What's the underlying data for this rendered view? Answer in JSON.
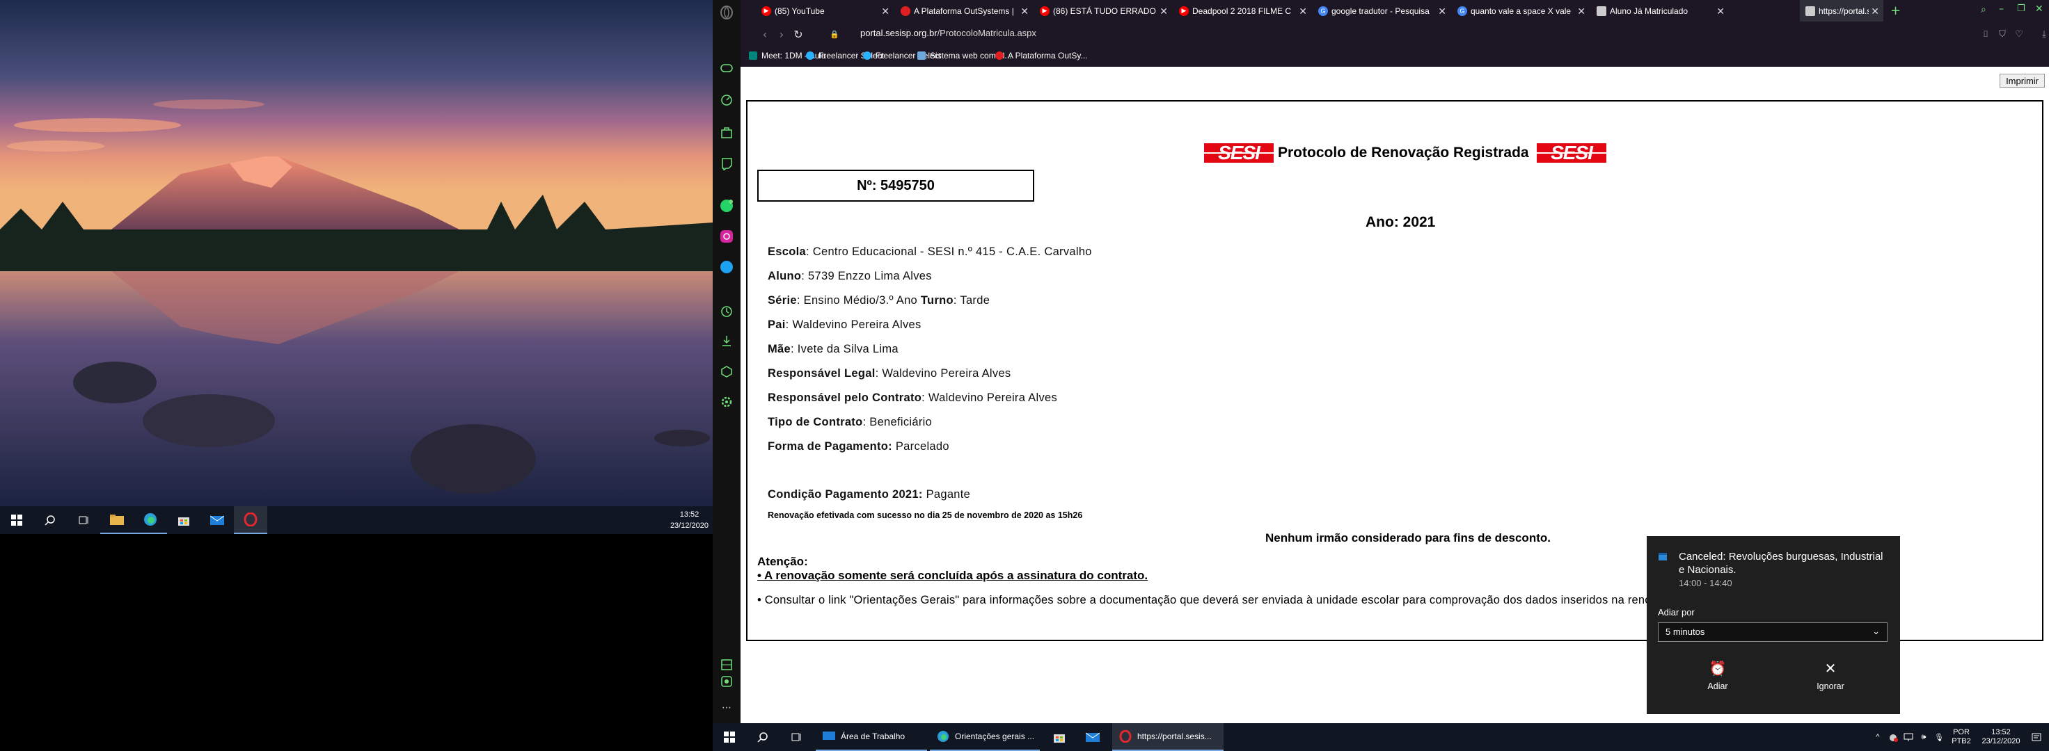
{
  "left_screen": {
    "clock_time": "13:52",
    "clock_date": "23/12/2020"
  },
  "browser": {
    "tabs": [
      {
        "label": "(85) YouTube",
        "icon": "youtube-icon",
        "color": "#ff0000"
      },
      {
        "label": "A Plataforma OutSystems |",
        "icon": "outsystems-icon",
        "color": "#e02020"
      },
      {
        "label": "(86) ESTÁ TUDO ERRADO C",
        "icon": "youtube-icon",
        "color": "#ff0000"
      },
      {
        "label": "Deadpool 2 2018 FILME C",
        "icon": "youtube-icon",
        "color": "#ff0000"
      },
      {
        "label": "google tradutor - Pesquisa",
        "icon": "google-icon",
        "color": "#4285f4"
      },
      {
        "label": "quanto vale a space X vale",
        "icon": "google-icon",
        "color": "#4285f4"
      },
      {
        "label": "Aluno Já Matriculado",
        "icon": "document-icon",
        "color": "#cccccc"
      },
      {
        "label": "https://portal.sesisp.org.br",
        "icon": "document-icon",
        "color": "#cccccc",
        "active": true
      }
    ],
    "url_host": "portal.sesisp.org.br",
    "url_path": "/ProtocoloMatricula.aspx",
    "bookmarks": [
      {
        "label": "Meet: 1DM - Aula",
        "icon": "meet-icon",
        "color": "#00897b"
      },
      {
        "label": "Freelancer Select",
        "icon": "freelancer-icon",
        "color": "#29b2fe"
      },
      {
        "label": "Freelancer Select",
        "icon": "freelancer-icon",
        "color": "#29b2fe"
      },
      {
        "label": "Sistema web com al...",
        "icon": "image-icon",
        "color": "#6fa8dc"
      },
      {
        "label": "A Plataforma OutSy...",
        "icon": "outsystems-icon",
        "color": "#e02020"
      }
    ]
  },
  "page": {
    "print_label": "Imprimir",
    "logo_text": "SESI",
    "title": "Protocolo de Renovação Registrada",
    "protocol_number": "Nº: 5495750",
    "year": "Ano: 2021",
    "fields": [
      {
        "label": "Escola",
        "value": ": Centro Educacional - SESI n.º 415 - C.A.E. Carvalho"
      },
      {
        "label": "Aluno",
        "value": ": 5739 Enzzo Lima Alves"
      },
      {
        "label": "Série",
        "value": ": Ensino Médio/3.º Ano ",
        "label2": "Turno",
        "value2": ": Tarde"
      },
      {
        "label": "Pai",
        "value": ": Waldevino Pereira Alves"
      },
      {
        "label": "Mãe",
        "value": ": Ivete da Silva Lima"
      },
      {
        "label": "Responsável Legal",
        "value": ": Waldevino Pereira Alves"
      },
      {
        "label": "Responsável pelo Contrato",
        "value": ": Waldevino Pereira Alves"
      },
      {
        "label": "Tipo de Contrato",
        "value": ": Beneficiário"
      },
      {
        "label": "Forma de Pagamento:",
        "value": " Parcelado"
      }
    ],
    "condicao_label": "Condição Pagamento 2021:",
    "condicao_value": " Pagante",
    "renovacao_note": "Renovação efetivada com sucesso no dia 25 de novembro de 2020 as 15h26",
    "irmao_note": "Nenhum irmão considerado para fins de desconto.",
    "atencao_title": "Atenção:",
    "atencao_bullet_1": "• A renovação somente será concluída após a assinatura do contrato.",
    "atencao_bullet_2": "• Consultar o link \"Orientações Gerais\" para informações sobre a documentação que deverá ser enviada à unidade escolar para comprovação dos dados inseridos na renovação.\""
  },
  "taskbar": {
    "apps": [
      {
        "label": "Área de Trabalho",
        "icon": "desktop-icon"
      },
      {
        "label": "Orientações gerais ...",
        "icon": "edge-icon"
      },
      {
        "label": "https://portal.sesis...",
        "icon": "opera-icon"
      }
    ],
    "lang_1": "POR",
    "lang_2": "PTB2",
    "clock_time": "13:52",
    "clock_date": "23/12/2020"
  },
  "toast": {
    "title": "Canceled: Revoluções burguesas, Industrial e Nacionais.",
    "time": "14:00 - 14:40",
    "snooze_label": "Adiar por",
    "snooze_value": "5 minutos",
    "snooze_button": "Adiar",
    "dismiss_button": "Ignorar"
  }
}
